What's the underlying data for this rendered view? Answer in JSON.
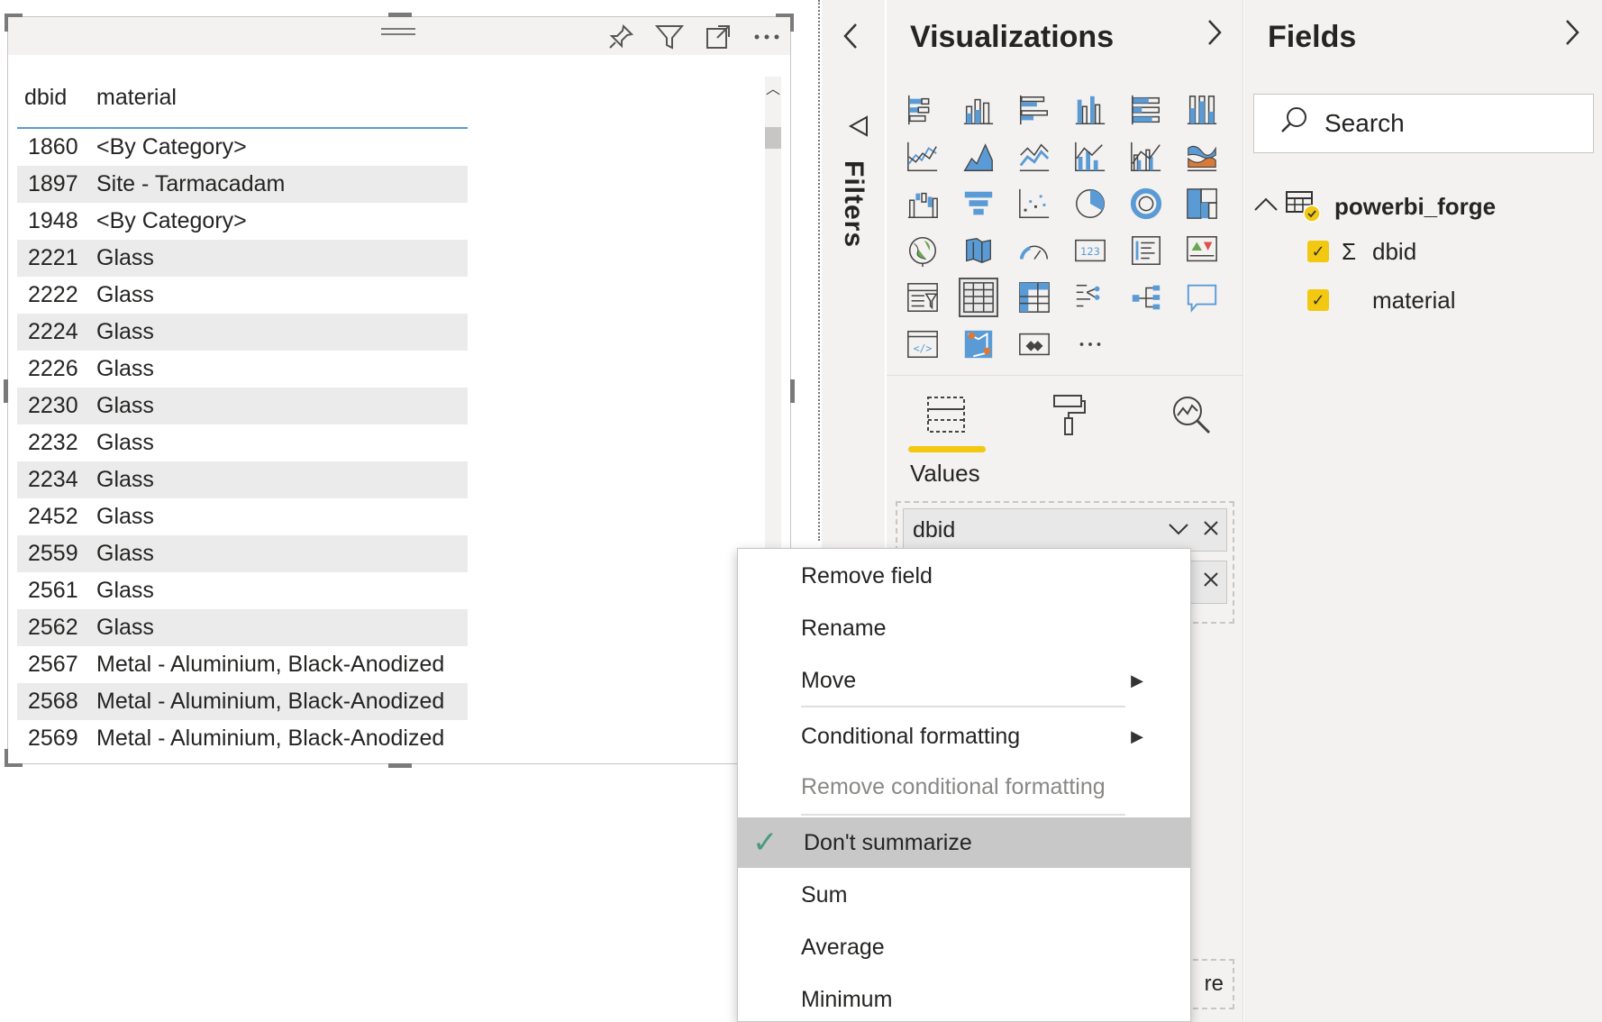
{
  "table": {
    "headers": {
      "id": "dbid",
      "material": "material"
    },
    "rows": [
      {
        "id": "1860",
        "material": "<By Category>"
      },
      {
        "id": "1897",
        "material": "Site - Tarmacadam"
      },
      {
        "id": "1948",
        "material": "<By Category>"
      },
      {
        "id": "2221",
        "material": "Glass"
      },
      {
        "id": "2222",
        "material": "Glass"
      },
      {
        "id": "2224",
        "material": "Glass"
      },
      {
        "id": "2226",
        "material": "Glass"
      },
      {
        "id": "2230",
        "material": "Glass"
      },
      {
        "id": "2232",
        "material": "Glass"
      },
      {
        "id": "2234",
        "material": "Glass"
      },
      {
        "id": "2452",
        "material": "Glass"
      },
      {
        "id": "2559",
        "material": "Glass"
      },
      {
        "id": "2561",
        "material": "Glass"
      },
      {
        "id": "2562",
        "material": "Glass"
      },
      {
        "id": "2567",
        "material": "Metal - Aluminium, Black-Anodized"
      },
      {
        "id": "2568",
        "material": "Metal - Aluminium, Black-Anodized"
      },
      {
        "id": "2569",
        "material": "Metal - Aluminium, Black-Anodized"
      }
    ]
  },
  "header_icons": [
    "pin-icon",
    "filter-icon",
    "focus-mode-icon",
    "more-options-icon"
  ],
  "filters": {
    "label": "Filters"
  },
  "visualizations": {
    "title": "Visualizations",
    "values_label": "Values",
    "well_fields": [
      {
        "label": "dbid"
      }
    ],
    "drill_well_text": "re",
    "icons": [
      "stacked-bar-icon",
      "stacked-column-icon",
      "clustered-bar-icon",
      "clustered-column-icon",
      "100-bar-icon",
      "100-column-icon",
      "line-chart-icon",
      "area-chart-icon",
      "stacked-area-icon",
      "line-column-icon",
      "line-clustered-column-icon",
      "ribbon-chart-icon",
      "waterfall-icon",
      "funnel-icon",
      "scatter-icon",
      "pie-icon",
      "donut-icon",
      "treemap-icon",
      "map-icon",
      "filled-map-icon",
      "gauge-icon",
      "card-icon",
      "multirow-card-icon",
      "kpi-icon",
      "slicer-icon",
      "table-icon",
      "matrix-icon",
      "decomposition-tree-icon",
      "key-influencers-icon",
      "qna-icon",
      "script-visual-icon",
      "arcgis-icon",
      "power-apps-icon",
      "more-visuals-icon"
    ],
    "selected_icon": "table-icon"
  },
  "fields": {
    "title": "Fields",
    "search_placeholder": "Search",
    "table_name": "powerbi_forge",
    "items": [
      {
        "name": "dbid",
        "sigma": "Σ"
      },
      {
        "name": "material",
        "sigma": ""
      }
    ]
  },
  "menu": {
    "items": [
      {
        "label": "Remove field"
      },
      {
        "label": "Rename"
      },
      {
        "label": "Move"
      },
      {
        "label": "Conditional formatting"
      },
      {
        "label": "Remove conditional formatting"
      },
      {
        "label": "Don't summarize"
      },
      {
        "label": "Sum"
      },
      {
        "label": "Average"
      },
      {
        "label": "Minimum"
      }
    ]
  },
  "colors": {
    "accent": "#f2c811",
    "header_underline": "#5b9bd5",
    "alt_row": "#ebebeb",
    "check": "#4c9a7e"
  }
}
